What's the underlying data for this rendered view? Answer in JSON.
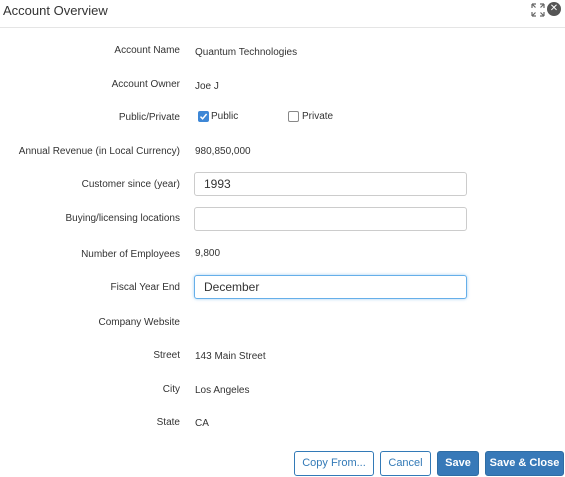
{
  "header": {
    "title": "Account Overview"
  },
  "fields": {
    "account_name": {
      "label": "Account Name",
      "value": "Quantum Technologies"
    },
    "account_owner": {
      "label": "Account Owner",
      "value": "Joe J"
    },
    "public_private": {
      "label": "Public/Private",
      "options": [
        {
          "label": "Public",
          "checked": true
        },
        {
          "label": "Private",
          "checked": false
        }
      ]
    },
    "annual_revenue": {
      "label": "Annual Revenue (in Local Currency)",
      "value": "980,850,000"
    },
    "customer_since": {
      "label": "Customer since (year)",
      "value": "1993"
    },
    "locations": {
      "label": "Buying/licensing locations",
      "value": ""
    },
    "employees": {
      "label": "Number of Employees",
      "value": "9,800"
    },
    "fiscal_year_end": {
      "label": "Fiscal Year End",
      "value": "December"
    },
    "website": {
      "label": "Company Website",
      "value": ""
    },
    "street": {
      "label": "Street",
      "value": "143 Main Street"
    },
    "city": {
      "label": "City",
      "value": "Los Angeles"
    },
    "state": {
      "label": "State",
      "value": "CA"
    }
  },
  "buttons": {
    "copy_from": "Copy From...",
    "cancel": "Cancel",
    "save": "Save",
    "save_close": "Save & Close"
  },
  "colors": {
    "accent": "#3779b8",
    "checkbox": "#3d87d6",
    "focus_border": "#66afe9"
  }
}
